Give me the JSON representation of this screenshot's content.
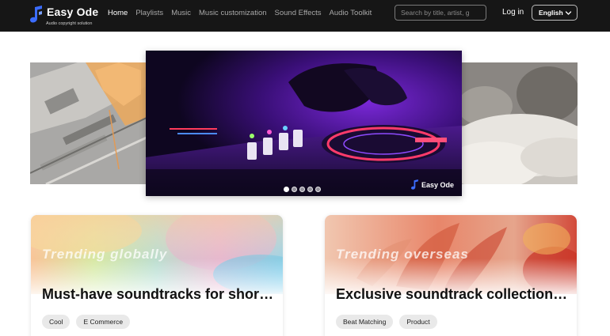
{
  "brand": {
    "name": "Easy Ode",
    "tagline": "Audio copyright solution",
    "accent": "#3b6cff"
  },
  "nav": {
    "items": [
      {
        "label": "Home",
        "active": true
      },
      {
        "label": "Playlists",
        "active": false
      },
      {
        "label": "Music",
        "active": false
      },
      {
        "label": "Music customization",
        "active": false
      },
      {
        "label": "Sound Effects",
        "active": false
      },
      {
        "label": "Audio Toolkit",
        "active": false
      }
    ]
  },
  "search": {
    "placeholder": "Search by title, artist, genre",
    "icon": "search-icon"
  },
  "header_actions": {
    "login_label": "Log in",
    "language": "English",
    "language_icon": "chevron-down-icon"
  },
  "carousel": {
    "main_slide_brand": "Easy Ode",
    "slide_count": 5,
    "active_index": 0
  },
  "cards": [
    {
      "kicker": "Trending globally",
      "title": "Must-have soundtracks for short videos",
      "tags": [
        "Cool",
        "E Commerce"
      ]
    },
    {
      "kicker": "Trending overseas",
      "title": "Exclusive soundtrack collection for overseas",
      "tags": [
        "Beat Matching",
        "Product"
      ]
    }
  ]
}
